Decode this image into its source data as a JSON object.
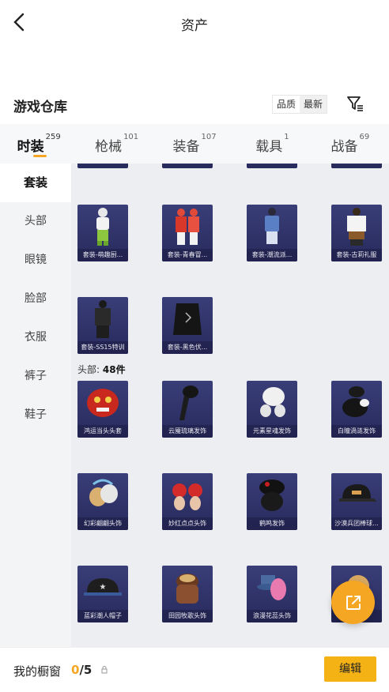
{
  "header": {
    "title": "资产"
  },
  "warehouse": {
    "title": "游戏仓库",
    "sort_options": [
      "品质",
      "最新"
    ],
    "sort_selected": "最新"
  },
  "tabs": [
    {
      "label": "时装",
      "count": "259"
    },
    {
      "label": "枪械",
      "count": "101"
    },
    {
      "label": "装备",
      "count": "107"
    },
    {
      "label": "载具",
      "count": "1"
    },
    {
      "label": "战备",
      "count": "69"
    }
  ],
  "side_menu": [
    "套装",
    "头部",
    "眼镜",
    "脸部",
    "衣服",
    "裤子",
    "鞋子"
  ],
  "sections": {
    "outfits": {
      "items": [
        {
          "name": "套装-萌趣厨...",
          "icon": "outfit-green"
        },
        {
          "name": "套装-青春冒...",
          "icon": "outfit-red-duo"
        },
        {
          "name": "套装-潮流派...",
          "icon": "outfit-blue"
        },
        {
          "name": "套装-古莉礼服",
          "icon": "outfit-white"
        },
        {
          "name": "套装-SS15特训",
          "icon": "outfit-black"
        },
        {
          "name": "套装-黑色伏...",
          "icon": "outfit-black-coat"
        }
      ]
    },
    "head": {
      "label": "头部:",
      "count": "48件",
      "items": [
        {
          "name": "鸿运当头头套",
          "icon": "lion-mask"
        },
        {
          "name": "云魇琉璃发饰",
          "icon": "hair-black-long"
        },
        {
          "name": "元素星魂发饰",
          "icon": "hair-white"
        },
        {
          "name": "白瞳渦涟发饰",
          "icon": "hair-black-short"
        },
        {
          "name": "幻彩翩翩头饰",
          "icon": "hair-blonde"
        },
        {
          "name": "妙红点点头饰",
          "icon": "hair-red-buns"
        },
        {
          "name": "鹤鸣发饰",
          "icon": "hair-black-bun"
        },
        {
          "name": "沙漠兵团棒球...",
          "icon": "cap-black"
        },
        {
          "name": "蓝彩潮人帽子",
          "icon": "cap-star"
        },
        {
          "name": "田园牧歌头饰",
          "icon": "hair-brown"
        },
        {
          "name": "浪漫花蕊头饰",
          "icon": "hat-blue-pink"
        },
        {
          "name": "",
          "icon": "hair-blonde-2"
        }
      ]
    }
  },
  "bottom": {
    "window_label": "我的橱窗",
    "current": "0",
    "total": "/5",
    "edit_label": "编辑"
  },
  "colors": {
    "accent": "#f5a623",
    "card_bg": "#2f3268"
  }
}
